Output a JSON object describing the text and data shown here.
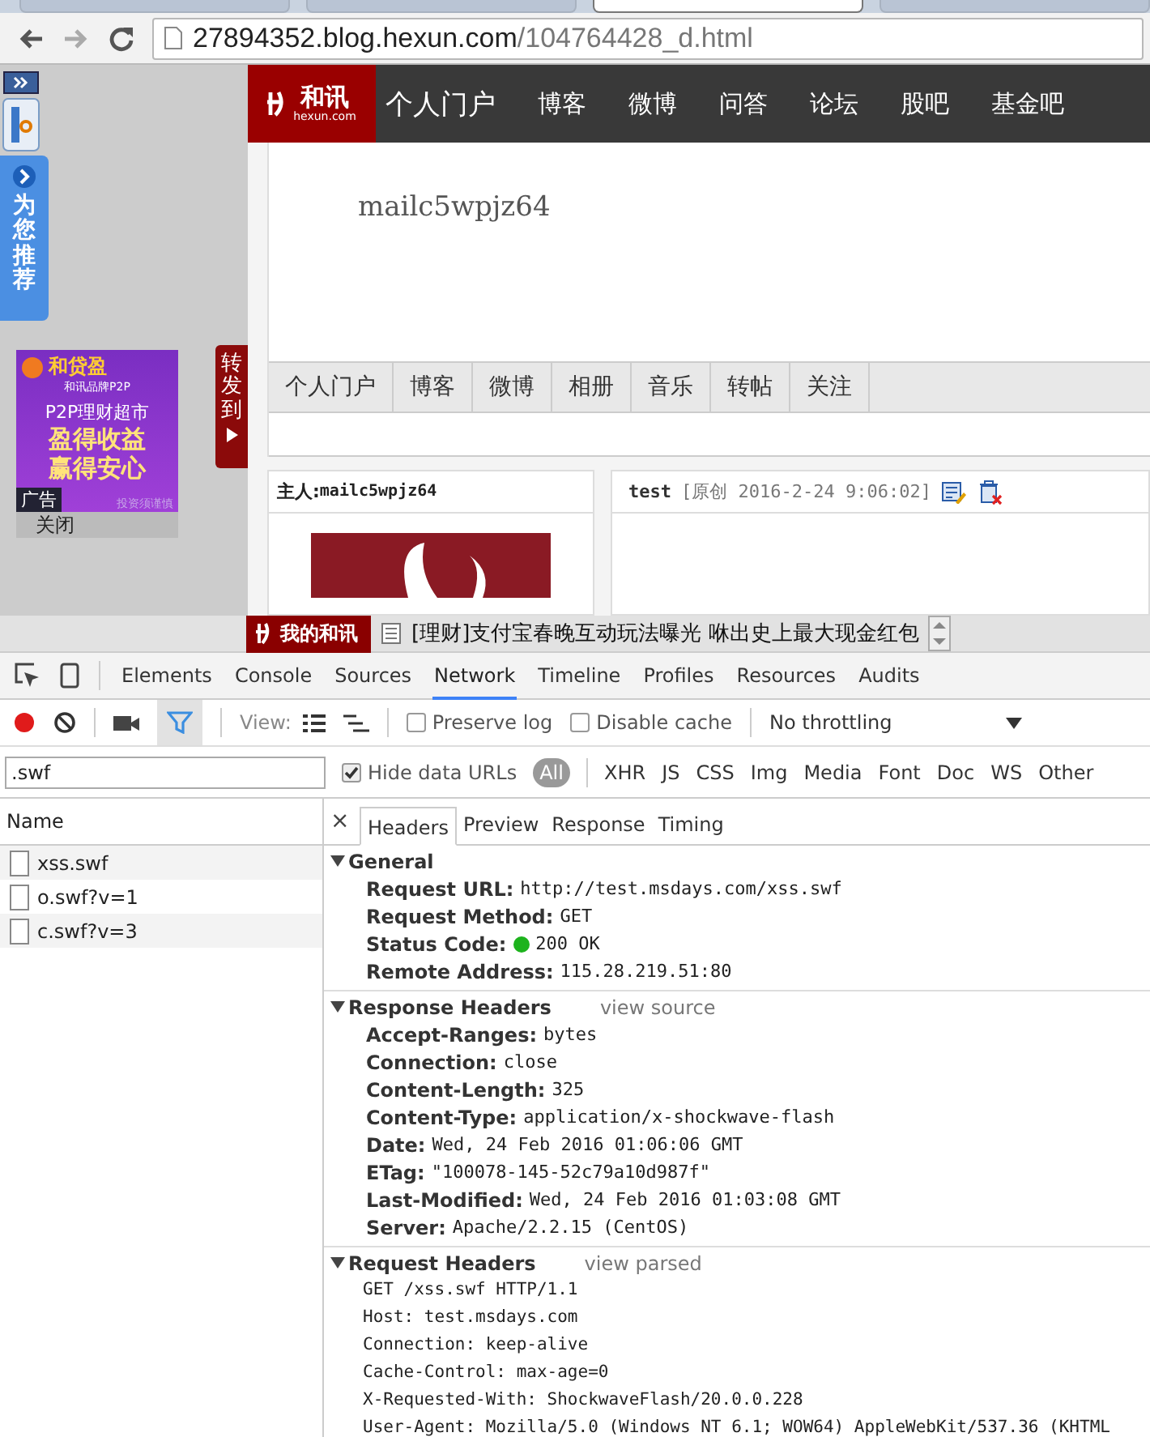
{
  "browser": {
    "tabs": [
      {
        "selected": false
      },
      {
        "selected": false
      },
      {
        "selected": true
      },
      {
        "selected": false
      }
    ],
    "url_host": "27894352.blog.hexun.com",
    "url_path": "/104764428_d.html"
  },
  "site_nav": {
    "logo_text": "和讯",
    "logo_sub": "hexun.com",
    "items": [
      "个人门户",
      "博客",
      "微博",
      "问答",
      "论坛",
      "股吧",
      "基金吧"
    ]
  },
  "side_widget": {
    "label": "为您推荐"
  },
  "ad": {
    "brand": "和贷盈",
    "brand_sub": "和讯品牌P2P",
    "line1": "P2P理财超市",
    "line2": "盈得收益",
    "line3": "赢得安心",
    "note": "投资须谨慎",
    "badge": "广告",
    "close": "关闭"
  },
  "share": {
    "label": "转发到"
  },
  "blog": {
    "title": "mailc5wpjz64",
    "tabs": [
      "个人门户",
      "博客",
      "微博",
      "相册",
      "音乐",
      "转帖",
      "关注"
    ],
    "owner_label": "主人:",
    "owner_name": "mailc5wpjz64",
    "post_title": "test",
    "post_meta": "[原创 2016-2-24 9:06:02]"
  },
  "bottom_bar": {
    "label": "我的和讯",
    "news": "[理财]支付宝春晚互动玩法曝光 咻出史上最大现金红包"
  },
  "devtools": {
    "tabs": [
      {
        "label": "Elements",
        "selected": false
      },
      {
        "label": "Console",
        "selected": false
      },
      {
        "label": "Sources",
        "selected": false
      },
      {
        "label": "Network",
        "selected": true
      },
      {
        "label": "Timeline",
        "selected": false
      },
      {
        "label": "Profiles",
        "selected": false
      },
      {
        "label": "Resources",
        "selected": false
      },
      {
        "label": "Audits",
        "selected": false
      }
    ],
    "recording": true,
    "filter_on": true,
    "view_label": "View:",
    "preserve_log": {
      "label": "Preserve log",
      "checked": false
    },
    "disable_cache": {
      "label": "Disable cache",
      "checked": false
    },
    "throttling": "No throttling",
    "filter_value": ".swf",
    "hide_data_urls": {
      "label": "Hide data URLs",
      "checked": true
    },
    "types": [
      {
        "label": "All",
        "selected": true
      },
      {
        "label": "XHR",
        "selected": false
      },
      {
        "label": "JS",
        "selected": false
      },
      {
        "label": "CSS",
        "selected": false
      },
      {
        "label": "Img",
        "selected": false
      },
      {
        "label": "Media",
        "selected": false
      },
      {
        "label": "Font",
        "selected": false
      },
      {
        "label": "Doc",
        "selected": false
      },
      {
        "label": "WS",
        "selected": false
      },
      {
        "label": "Other",
        "selected": false
      }
    ],
    "name_header": "Name",
    "requests": [
      {
        "name": "xss.swf"
      },
      {
        "name": "o.swf?v=1"
      },
      {
        "name": "c.swf?v=3"
      }
    ],
    "close_char": "×",
    "detail_tabs": [
      {
        "label": "Headers",
        "selected": true
      },
      {
        "label": "Preview",
        "selected": false
      },
      {
        "label": "Response",
        "selected": false
      },
      {
        "label": "Timing",
        "selected": false
      }
    ],
    "sections": [
      {
        "title": "General",
        "expanded": true,
        "rows": [
          {
            "key": "Request URL:",
            "value": "http://test.msdays.com/xss.swf"
          },
          {
            "key": "Request Method:",
            "value": "GET"
          },
          {
            "key": "Status Code:",
            "value": "200 OK",
            "color": "#1db31d"
          },
          {
            "key": "Remote Address:",
            "value": "115.28.219.51:80"
          }
        ]
      },
      {
        "title": "Response Headers",
        "expanded": true,
        "link": "view source",
        "rows": [
          {
            "key": "Accept-Ranges:",
            "value": "bytes"
          },
          {
            "key": "Connection:",
            "value": "close"
          },
          {
            "key": "Content-Length:",
            "value": "325"
          },
          {
            "key": "Content-Type:",
            "value": "application/x-shockwave-flash"
          },
          {
            "key": "Date:",
            "value": "Wed, 24 Feb 2016 01:06:06 GMT"
          },
          {
            "key": "ETag:",
            "value": "\"100078-145-52c79a10d987f\""
          },
          {
            "key": "Last-Modified:",
            "value": "Wed, 24 Feb 2016 01:03:08 GMT"
          },
          {
            "key": "Server:",
            "value": "Apache/2.2.15 (CentOS)"
          }
        ]
      },
      {
        "title": "Request Headers",
        "expanded": true,
        "link": "view parsed",
        "lines": [
          "GET /xss.swf HTTP/1.1",
          "Host: test.msdays.com",
          "Connection: keep-alive",
          "Cache-Control: max-age=0",
          "X-Requested-With: ShockwaveFlash/20.0.0.228",
          "User-Agent: Mozilla/5.0 (Windows NT 6.1; WOW64) AppleWebKit/537.36 (KHTML"
        ]
      }
    ]
  }
}
